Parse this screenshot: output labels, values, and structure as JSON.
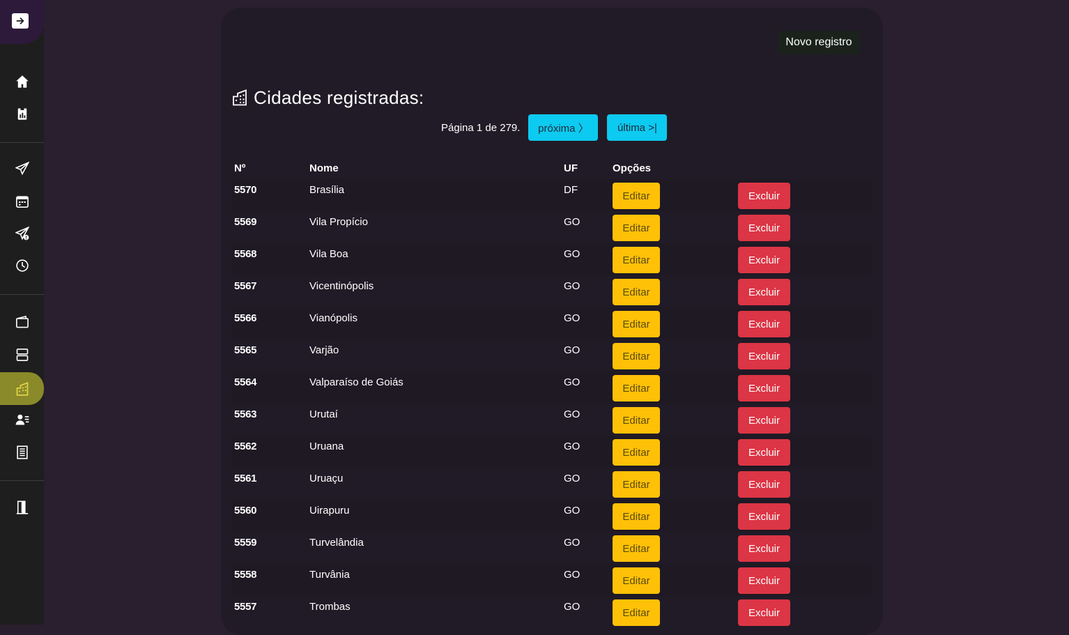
{
  "sidebar": {
    "expand_icon": "arrow-right-icon",
    "items": [
      {
        "icon": "house-icon"
      },
      {
        "icon": "clipboard-data-icon"
      },
      {
        "icon": "send-icon"
      },
      {
        "icon": "calendar-icon"
      },
      {
        "icon": "send-exclamation-icon"
      },
      {
        "icon": "clock-history-icon"
      },
      {
        "icon": "wallet-icon"
      },
      {
        "icon": "server-icon"
      },
      {
        "icon": "buildings-icon",
        "active": true
      },
      {
        "icon": "person-lines-icon"
      },
      {
        "icon": "building-icon"
      },
      {
        "icon": "door-exit-icon"
      }
    ],
    "active_color": "#8a8a2a"
  },
  "header": {
    "new_button": "Novo registro",
    "title": "Cidades registradas:"
  },
  "pagination": {
    "text": "Página 1 de 279.",
    "next": "próxima 〉",
    "last": "última >|"
  },
  "table": {
    "columns": [
      "Nº",
      "Nome",
      "UF",
      "Opções"
    ],
    "edit_label": "Editar",
    "delete_label": "Excluir",
    "rows": [
      {
        "id": "5570",
        "name": "Brasília",
        "uf": "DF"
      },
      {
        "id": "5569",
        "name": "Vila Propício",
        "uf": "GO"
      },
      {
        "id": "5568",
        "name": "Vila Boa",
        "uf": "GO"
      },
      {
        "id": "5567",
        "name": "Vicentinópolis",
        "uf": "GO"
      },
      {
        "id": "5566",
        "name": "Vianópolis",
        "uf": "GO"
      },
      {
        "id": "5565",
        "name": "Varjão",
        "uf": "GO"
      },
      {
        "id": "5564",
        "name": "Valparaíso de Goiás",
        "uf": "GO"
      },
      {
        "id": "5563",
        "name": "Urutaí",
        "uf": "GO"
      },
      {
        "id": "5562",
        "name": "Uruana",
        "uf": "GO"
      },
      {
        "id": "5561",
        "name": "Uruaçu",
        "uf": "GO"
      },
      {
        "id": "5560",
        "name": "Uirapuru",
        "uf": "GO"
      },
      {
        "id": "5559",
        "name": "Turvelândia",
        "uf": "GO"
      },
      {
        "id": "5558",
        "name": "Turvânia",
        "uf": "GO"
      },
      {
        "id": "5557",
        "name": "Trombas",
        "uf": "GO"
      }
    ]
  },
  "colors": {
    "background": "#2a1f2e",
    "card": "#211b27",
    "info": "#0dcaf0",
    "warning": "#ffc107",
    "danger": "#dc3545"
  }
}
